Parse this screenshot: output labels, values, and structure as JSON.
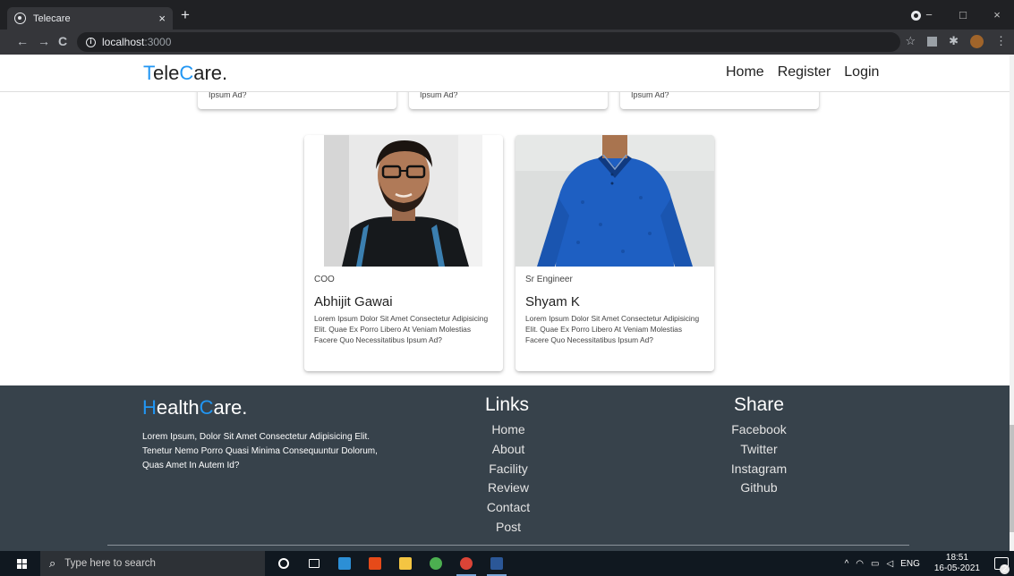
{
  "browser": {
    "tab_title": "Telecare",
    "tab_close": "×",
    "new_tab": "+",
    "url_host": "localhost",
    "url_port": ":3000",
    "nav_back": "←",
    "nav_forward": "→",
    "nav_reload": "C",
    "window_min": "−",
    "window_max": "□",
    "window_close": "×",
    "bookmark_star": "☆",
    "puzzle": "✱",
    "menu": "⋮"
  },
  "header": {
    "logo_first": "T",
    "logo_mid": "ele",
    "logo_accent": "C",
    "logo_rest": "are.",
    "nav": [
      {
        "label": "Home"
      },
      {
        "label": "Register"
      },
      {
        "label": "Login"
      }
    ]
  },
  "stub_cards": [
    {
      "text": "Ipsum Ad?"
    },
    {
      "text": "Ipsum Ad?"
    },
    {
      "text": "Ipsum Ad?"
    }
  ],
  "team": [
    {
      "role": "COO",
      "name": "Abhijit Gawai",
      "desc": "Lorem Ipsum Dolor Sit Amet Consectetur Adipisicing Elit. Quae Ex Porro Libero At Veniam Molestias Facere Quo Necessitatibus Ipsum Ad?"
    },
    {
      "role": "Sr Engineer",
      "name": "Shyam K",
      "desc": "Lorem Ipsum Dolor Sit Amet Consectetur Adipisicing Elit. Quae Ex Porro Libero At Veniam Molestias Facere Quo Necessitatibus Ipsum Ad?"
    }
  ],
  "footer": {
    "logo_accent1": "H",
    "logo_part1": "ealth",
    "logo_accent2": "C",
    "logo_part2": "are.",
    "about": "Lorem Ipsum, Dolor Sit Amet Consectetur Adipisicing Elit. Tenetur Nemo Porro Quasi Minima Consequuntur Dolorum, Quas Amet In Autem Id?",
    "links_title": "Links",
    "links": [
      {
        "label": "Home"
      },
      {
        "label": "About"
      },
      {
        "label": "Facility"
      },
      {
        "label": "Review"
      },
      {
        "label": "Contact"
      },
      {
        "label": "Post"
      }
    ],
    "share_title": "Share",
    "share": [
      {
        "label": "Facebook"
      },
      {
        "label": "Twitter"
      },
      {
        "label": "Instagram"
      },
      {
        "label": "Github"
      }
    ]
  },
  "taskbar": {
    "search_placeholder": "Type here to search",
    "tray_lang": "ENG",
    "time": "18:51",
    "date": "16-05-2021",
    "notification_count": "2"
  },
  "colors": {
    "accent": "#2196f3",
    "footer_bg": "#37424b",
    "chrome_dark": "#202124"
  }
}
